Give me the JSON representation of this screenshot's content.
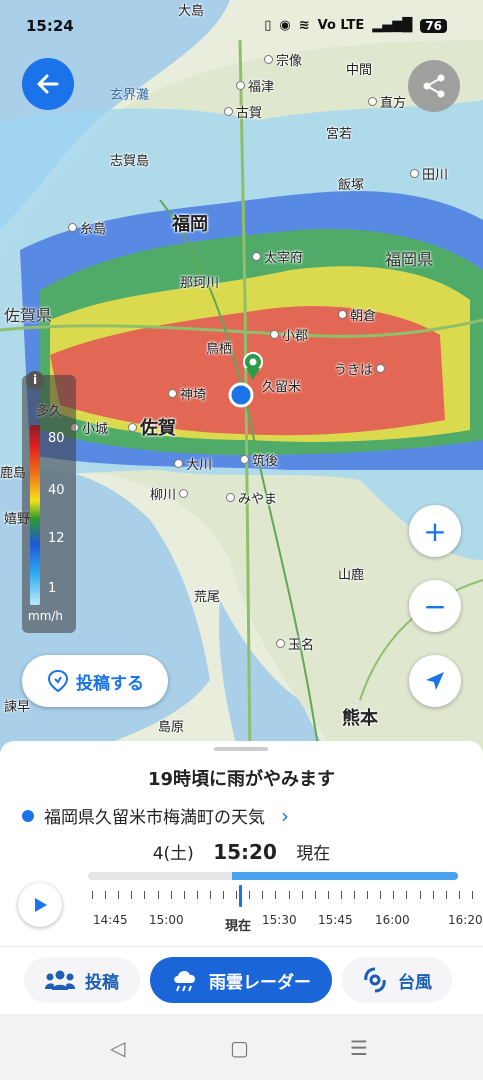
{
  "status_bar": {
    "time": "15:24",
    "volte": "Vo LTE",
    "battery": "76"
  },
  "map": {
    "seas": [
      "玄界灘"
    ],
    "prefectures": [
      "福岡県",
      "佐賀県"
    ],
    "cities": [
      "大島",
      "宗像",
      "福津",
      "古賀",
      "中間",
      "直方",
      "宮若",
      "飯塚",
      "田川",
      "糸島",
      "志賀島",
      "福岡",
      "太宰府",
      "那珂川",
      "小郡",
      "朝倉",
      "鳥栖",
      "うきは",
      "神埼",
      "久留米",
      "多久",
      "小城",
      "佐賀",
      "大川",
      "筑後",
      "柳川",
      "みやま",
      "嬉野",
      "鹿島",
      "山鹿",
      "荒尾",
      "玉名",
      "熊本",
      "島原",
      "諫早"
    ]
  },
  "legend": {
    "info_icon": "i",
    "levels": [
      "80",
      "40",
      "12",
      "1"
    ],
    "unit": "mm/h"
  },
  "post_button": {
    "label": "投稿する"
  },
  "sheet": {
    "headline": "19時頃に雨がやみます",
    "location": "福岡県久留米市梅満町の天気",
    "date": "4(土)",
    "time": "15:20",
    "now_label": "現在",
    "timeline_labels": [
      "14:45",
      "15:00",
      "現在",
      "15:30",
      "15:45",
      "16:00",
      "16:20"
    ]
  },
  "tabs": [
    {
      "label": "投稿",
      "icon": "people-icon"
    },
    {
      "label": "雨雲レーダー",
      "icon": "rain-cloud-icon",
      "active": true
    },
    {
      "label": "台風",
      "icon": "typhoon-icon"
    }
  ],
  "colors": {
    "accent": "#1a73e8",
    "active_tab": "#1a66d9"
  }
}
